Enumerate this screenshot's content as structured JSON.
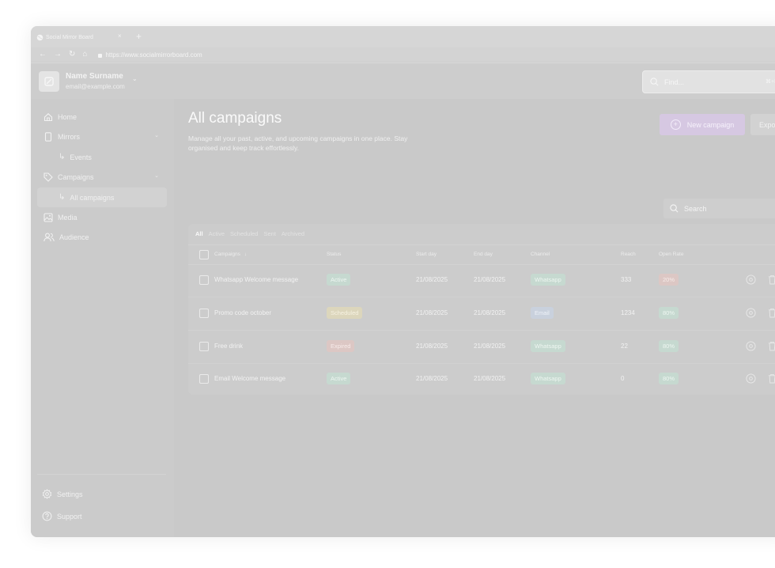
{
  "browser": {
    "tab_title": "Social Mirror Board",
    "tab_close": "×",
    "new_tab": "+",
    "url": "https://www.socialmirrorboard.com",
    "minimize": "—"
  },
  "header": {
    "user_name": "Name Surname",
    "user_email": "email@example.com",
    "find_placeholder": "Find...",
    "find_shortcut": "⌘+K"
  },
  "sidebar": {
    "home": "Home",
    "mirrors": "Mirrors",
    "events": "Events",
    "campaigns": "Campaigns",
    "all_campaigns": "All campaigns",
    "media": "Media",
    "audience": "Audience",
    "settings": "Settings",
    "support": "Support"
  },
  "main": {
    "title": "All campaigns",
    "description": "Manage all your past, active, and upcoming campaigns in one place. Stay organised and keep track effortlessly.",
    "new_campaign": "New campaign",
    "export": "Export",
    "search_placeholder": "Search"
  },
  "table": {
    "filters": [
      "All",
      "Active",
      "Scheduled",
      "Sent",
      "Archived"
    ],
    "active_filter": "All",
    "headers": {
      "campaigns": "Campaigns",
      "sort_arrow": "↓",
      "status": "Status",
      "start_day": "Start day",
      "end_day": "End day",
      "channel": "Channel",
      "reach": "Reach",
      "open_rate": "Open Rate"
    },
    "rows": [
      {
        "name": "Whatsapp Welcome message",
        "status": "Active",
        "start": "21/08/2025",
        "end": "21/08/2025",
        "channel": "Whatsapp",
        "reach": "333",
        "open_rate": "20%"
      },
      {
        "name": "Promo code october",
        "status": "Scheduled",
        "start": "21/08/2025",
        "end": "21/08/2025",
        "channel": "Email",
        "reach": "1234",
        "open_rate": "80%"
      },
      {
        "name": "Free drink",
        "status": "Expired",
        "start": "21/08/2025",
        "end": "21/08/2025",
        "channel": "Whatsapp",
        "reach": "22",
        "open_rate": "80%"
      },
      {
        "name": "Email Welcome message",
        "status": "Active",
        "start": "21/08/2025",
        "end": "21/08/2025",
        "channel": "Whatsapp",
        "reach": "0",
        "open_rate": "80%"
      }
    ]
  },
  "colors": {
    "accent_purple": "#d6c8e2",
    "badge_green": "#c6d9d0",
    "badge_yellow": "#dcd6bc",
    "badge_red": "#dcc7c4",
    "badge_blue": "#c9d1dd"
  }
}
